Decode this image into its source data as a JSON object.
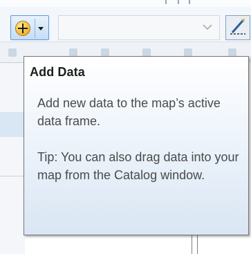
{
  "tooltip": {
    "title": "Add Data",
    "description": "Add new data to the map’s active data frame.",
    "tip": "Tip: You can also drag data into your map from the Catalog window."
  },
  "toolbar": {
    "add_data_button_icon": "add-data-icon",
    "dropdown_icon": "chevron-down-icon",
    "editor_icon": "editor-toolbar-icon"
  },
  "colors": {
    "tooltip_border": "#767676",
    "tooltip_gradient_bottom": "#dae6f4",
    "button_highlight": "#5d97d8"
  }
}
